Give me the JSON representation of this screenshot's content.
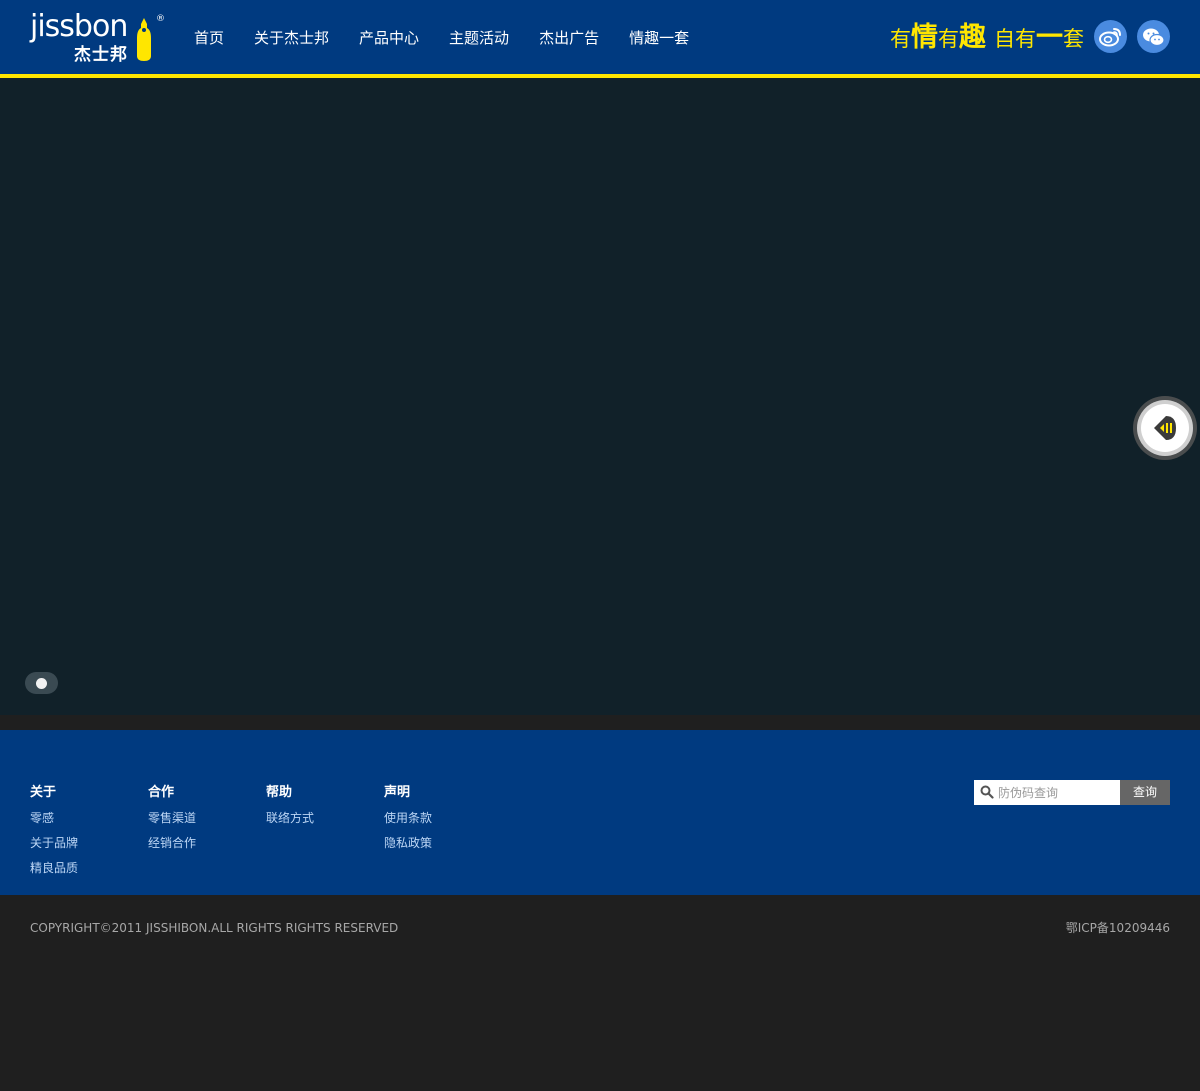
{
  "header": {
    "logo_text": "jissbon",
    "logo_cn": "杰士邦",
    "logo_reg": "®",
    "nav": [
      {
        "label": "首页"
      },
      {
        "label": "关于杰士邦"
      },
      {
        "label": "产品中心"
      },
      {
        "label": "主题活动"
      },
      {
        "label": "杰出广告"
      },
      {
        "label": "情趣一套"
      }
    ],
    "slogan": {
      "p1": "有",
      "p2": "情",
      "p3": "有",
      "p4": "趣",
      "p5": "自有",
      "p6": "一",
      "p7": "套"
    },
    "social": [
      "weibo-icon",
      "wechat-icon"
    ]
  },
  "colors": {
    "header_bg": "#003a80",
    "accent_yellow": "#ffe600",
    "banner_bg": "#112129",
    "footer_bg": "#003a80",
    "bottom_bg": "#1f1f1f"
  },
  "banner": {
    "pager_count": 1,
    "active_index": 0
  },
  "footer": {
    "columns": [
      {
        "title": "关于",
        "links": [
          "零感",
          "关于品牌",
          "精良品质"
        ]
      },
      {
        "title": "合作",
        "links": [
          "零售渠道",
          "经销合作"
        ]
      },
      {
        "title": "帮助",
        "links": [
          "联络方式"
        ]
      },
      {
        "title": "声明",
        "links": [
          "使用条款",
          "隐私政策"
        ]
      }
    ],
    "search": {
      "placeholder": "防伪码查询",
      "button": "查询"
    },
    "copyright": "COPYRIGHT©2011 JISSHIBON.ALL RIGHTS RIGHTS RESERVED",
    "icp": "鄂ICP备10209446"
  }
}
